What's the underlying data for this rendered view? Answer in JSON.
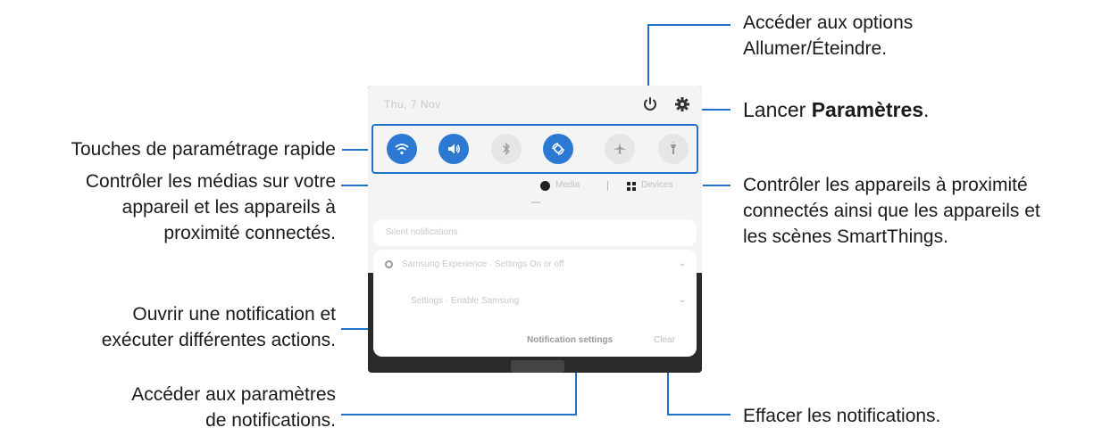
{
  "panel": {
    "date": "Thu, 7 Nov",
    "media_label": "Media",
    "devices_label": "Devices",
    "card1_text": "Silent notifications",
    "card2_line1": "Samsung Experience · Settings On or off",
    "card2_line2": "Settings · Enable Samsung",
    "notification_settings": "Notification settings",
    "clear": "Clear",
    "quick_settings": [
      {
        "name": "wifi",
        "state": "on"
      },
      {
        "name": "sound",
        "state": "on"
      },
      {
        "name": "bluetooth",
        "state": "off"
      },
      {
        "name": "auto-rotate",
        "state": "on"
      },
      {
        "name": "airplane",
        "state": "off"
      },
      {
        "name": "flashlight",
        "state": "off"
      }
    ]
  },
  "callouts": {
    "power_line1": "Accéder aux options",
    "power_line2": "Allumer/Éteindre.",
    "settings_prefix": "Lancer ",
    "settings_bold": "Paramètres",
    "settings_suffix": ".",
    "quick_settings": "Touches de paramétrage rapide",
    "media_line1": "Contrôler les médias sur votre",
    "media_line2": "appareil et les appareils à",
    "media_line3": "proximité connectés.",
    "devices_line1": "Contrôler les appareils à proximité",
    "devices_line2": "connectés ainsi que les appareils et",
    "devices_line3": "les scènes SmartThings.",
    "notification_line1": "Ouvrir une notification et",
    "notification_line2": "exécuter différentes actions.",
    "notif_settings_line1": "Accéder aux paramètres",
    "notif_settings_line2": "de notifications.",
    "clear": "Effacer les notifications."
  },
  "colors": {
    "accent": "#2c79d4",
    "outline": "#1e73c8"
  }
}
